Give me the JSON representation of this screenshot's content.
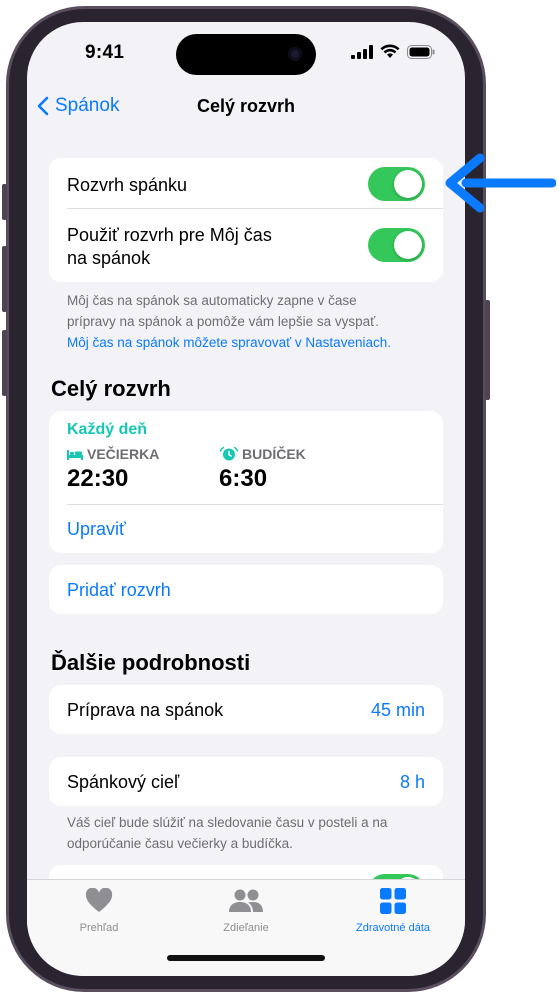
{
  "status_bar": {
    "time": "9:41"
  },
  "nav": {
    "back_label": "Spánok",
    "title": "Celý rozvrh"
  },
  "toggles_card": {
    "rows": [
      {
        "label": "Rozvrh spánku",
        "enabled": true
      },
      {
        "label_line1": "Použiť rozvrh pre Môj čas",
        "label_line2": "na spánok",
        "enabled": true
      }
    ]
  },
  "toggles_footnote": {
    "line1": "Môj čas na spánok sa automaticky zapne v čase",
    "line2": "prípravy na spánok a pomôže vám lepšie sa vyspať.",
    "link": "Môj čas na spánok môžete spravovať v Nastaveniach."
  },
  "full_schedule": {
    "title": "Celý rozvrh",
    "days": "Každý deň",
    "bedtime_label": "VEČIERKA",
    "bedtime_value": "22:30",
    "wake_label": "BUDÍČEK",
    "wake_value": "6:30",
    "edit_label": "Upraviť",
    "add_label": "Pridať rozvrh"
  },
  "more_details": {
    "title": "Ďalšie podrobnosti",
    "wind_down_label": "Príprava na spánok",
    "wind_down_value": "45 min",
    "sleep_goal_label": "Spánkový cieľ",
    "sleep_goal_value": "8 h",
    "footnote_line1": "Váš cieľ bude slúžiť na sledovanie času v posteli a na",
    "footnote_line2": "odporúčanie času večierky a budíčka."
  },
  "tabbar": {
    "tabs": [
      {
        "label": "Prehľad",
        "icon": "heart-icon",
        "active": false
      },
      {
        "label": "Zdieľanie",
        "icon": "people-icon",
        "active": false
      },
      {
        "label": "Zdravotné dáta",
        "icon": "grid-icon",
        "active": true
      }
    ]
  },
  "colors": {
    "accent": "#0a7aff",
    "toggle_on": "#34c759",
    "teal": "#16c7b3",
    "callout_arrow": "#0a7aff"
  }
}
